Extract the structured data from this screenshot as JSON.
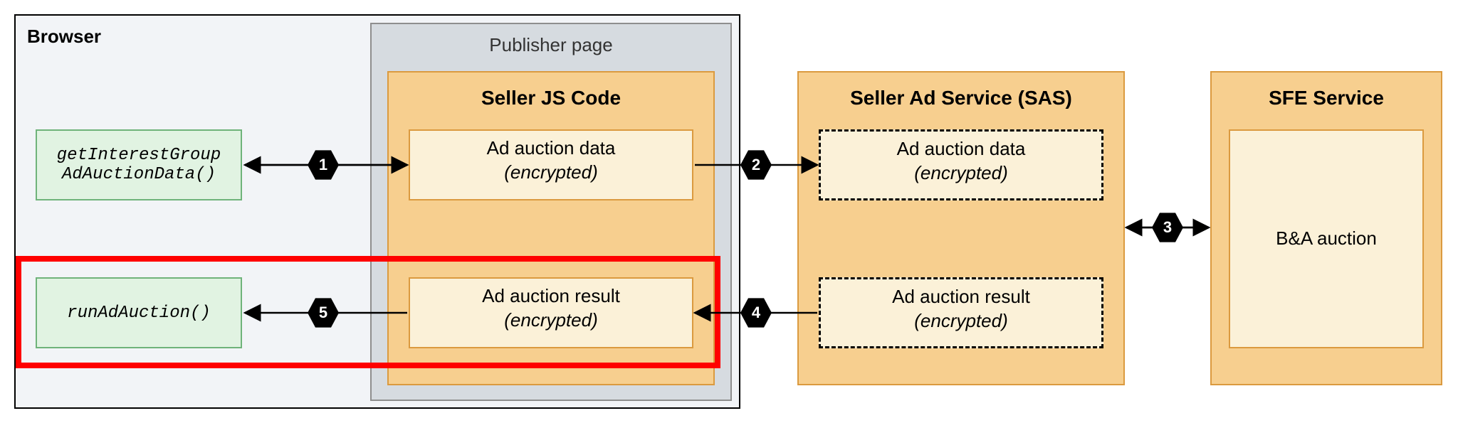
{
  "browser": {
    "label": "Browser",
    "api1": "getInterestGroup\nAdAuctionData()",
    "api2": "runAdAuction()",
    "publisherPage": {
      "label": "Publisher page",
      "sellerJs": {
        "label": "Seller JS Code",
        "box1_line1": "Ad auction data",
        "box1_line2": "(encrypted)",
        "box2_line1": "Ad auction result",
        "box2_line2": "(encrypted)"
      }
    }
  },
  "sas": {
    "label": "Seller Ad Service (SAS)",
    "box1_line1": "Ad auction data",
    "box1_line2": "(encrypted)",
    "box2_line1": "Ad auction result",
    "box2_line2": "(encrypted)"
  },
  "sfe": {
    "label": "SFE Service",
    "box_line1": "B&A auction"
  },
  "steps": {
    "s1": "1",
    "s2": "2",
    "s3": "3",
    "s4": "4",
    "s5": "5"
  },
  "colors": {
    "browserFill": "#f2f4f7",
    "publisherFill": "#d6dbe0",
    "orangeFill": "#f7cf8f",
    "orangeBorder": "#db9a3f",
    "creamFill": "#fbf1d8",
    "greenFill": "#e1f3e2",
    "greenBorder": "#6fb37a",
    "highlight": "#ff0000"
  }
}
